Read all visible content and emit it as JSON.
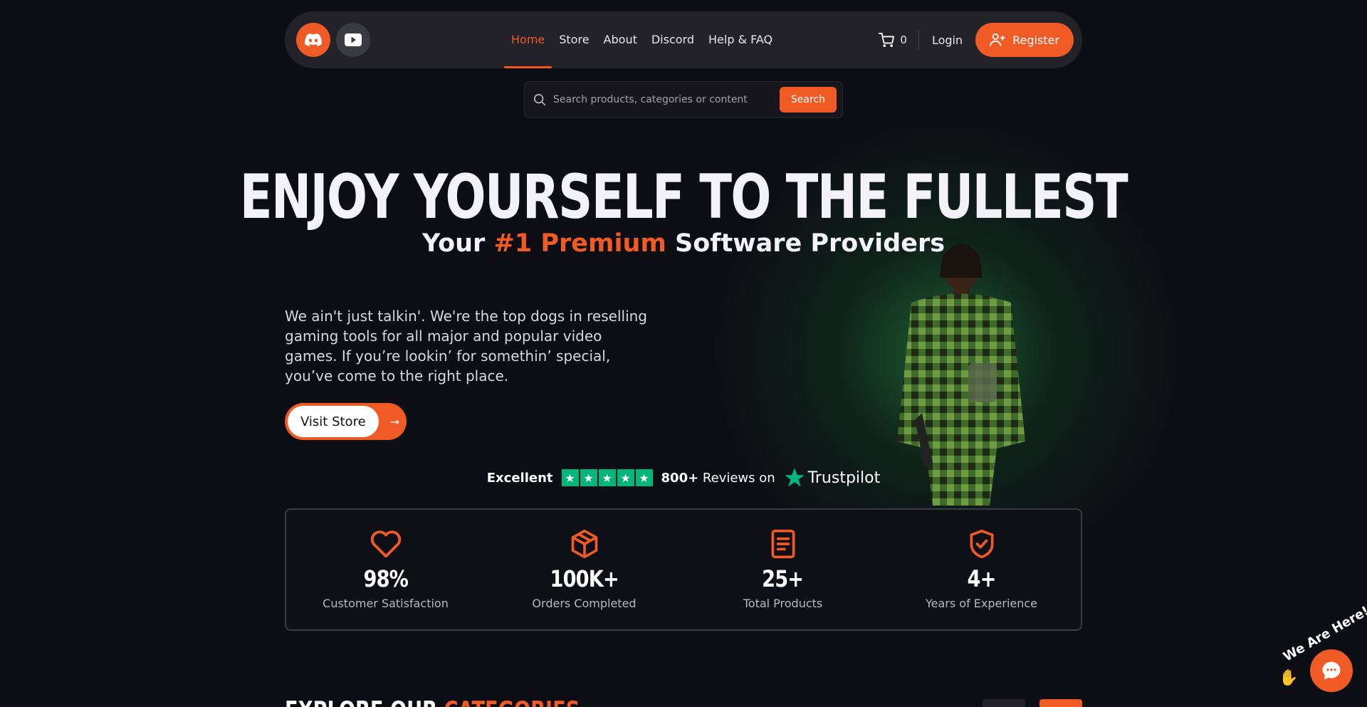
{
  "nav": {
    "social": [
      {
        "name": "discord-icon",
        "color": "#f05a24"
      },
      {
        "name": "youtube-icon",
        "color": "#3a3a42"
      }
    ],
    "menu": [
      {
        "label": "Home",
        "active": true
      },
      {
        "label": "Store",
        "active": false
      },
      {
        "label": "About",
        "active": false
      },
      {
        "label": "Discord",
        "active": false
      },
      {
        "label": "Help & FAQ",
        "active": false
      }
    ],
    "cart_count": "0",
    "login_label": "Login",
    "register_label": "Register"
  },
  "search": {
    "placeholder": "Search products, categories or content",
    "button_label": "Search"
  },
  "hero": {
    "title": "ENJOY YOURSELF TO THE FULLEST",
    "subtitle_pre": "Your ",
    "subtitle_highlight": "#1 Premium",
    "subtitle_post": " Software Providers",
    "description": "We ain't just talkin'. We're the top dogs in reselling gaming tools for all major and popular video games. If you’re lookin’ for somethin’ special, you’ve come to the right place.",
    "cta_label": "Visit Store"
  },
  "trust": {
    "rating_label": "Excellent",
    "reviews_count": "800+",
    "reviews_text": "Reviews on",
    "brand": "Trustpilot"
  },
  "stats": [
    {
      "value": "98%",
      "label": "Customer Satisfaction",
      "icon": "heart-icon"
    },
    {
      "value": "100K+",
      "label": "Orders Completed",
      "icon": "box-icon"
    },
    {
      "value": "25+",
      "label": "Total Products",
      "icon": "document-icon"
    },
    {
      "value": "4+",
      "label": "Years of Experience",
      "icon": "shield-check-icon"
    }
  ],
  "explore": {
    "title_pre": "EXPLORE OUR ",
    "title_highlight": "CATEGORIES"
  },
  "chat": {
    "badge": "We Are Here!"
  },
  "colors": {
    "accent": "#f05a24",
    "background": "#0d0d14",
    "trustpilot": "#00b67a"
  }
}
